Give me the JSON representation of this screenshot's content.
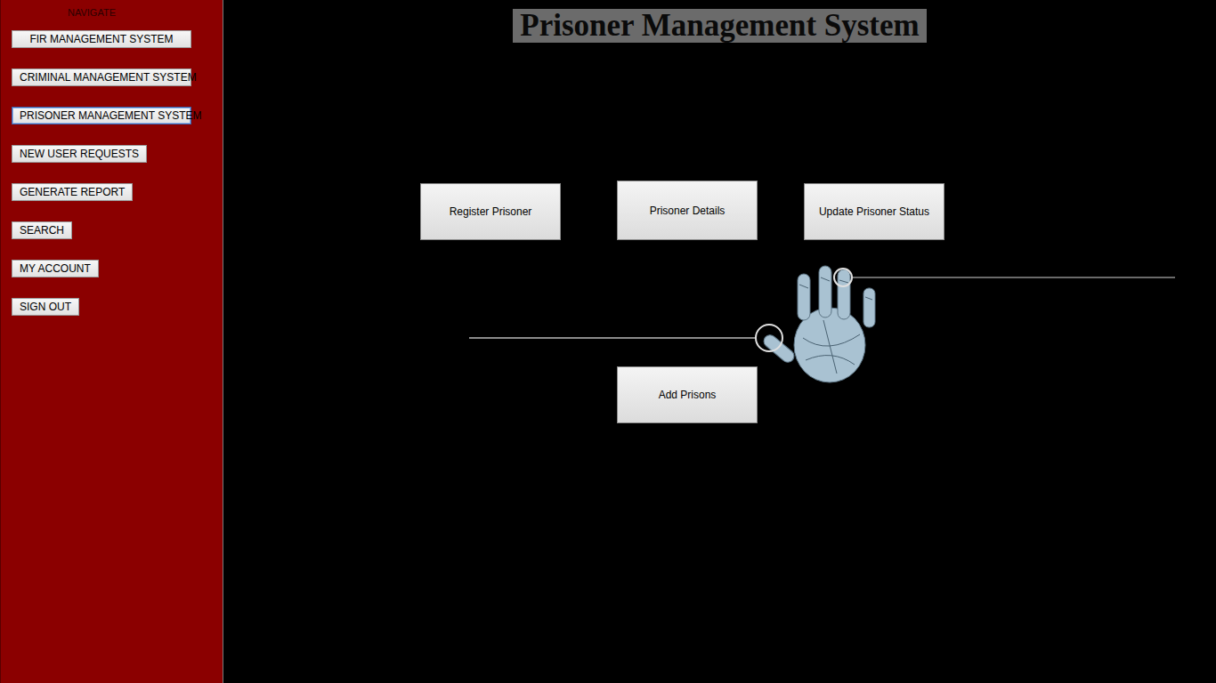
{
  "window": {
    "title": "Prisoner Management System"
  },
  "sidebar": {
    "heading": "NAVIGATE",
    "items": [
      {
        "label": "FIR MANAGEMENT SYSTEM",
        "selected": false
      },
      {
        "label": "CRIMINAL MANAGEMENT SYSTEM",
        "selected": false
      },
      {
        "label": "PRISONER MANAGEMENT SYSTEM",
        "selected": true
      },
      {
        "label": "NEW USER REQUESTS",
        "selected": false
      },
      {
        "label": "GENERATE REPORT",
        "selected": false
      },
      {
        "label": "SEARCH",
        "selected": false
      },
      {
        "label": "MY ACCOUNT",
        "selected": false
      },
      {
        "label": "SIGN OUT",
        "selected": false
      }
    ]
  },
  "actions": [
    "Register Prisoner",
    "Prisoner Details",
    "Update Prisoner Status"
  ],
  "secondary_actions": [
    "Add Prisons"
  ]
}
